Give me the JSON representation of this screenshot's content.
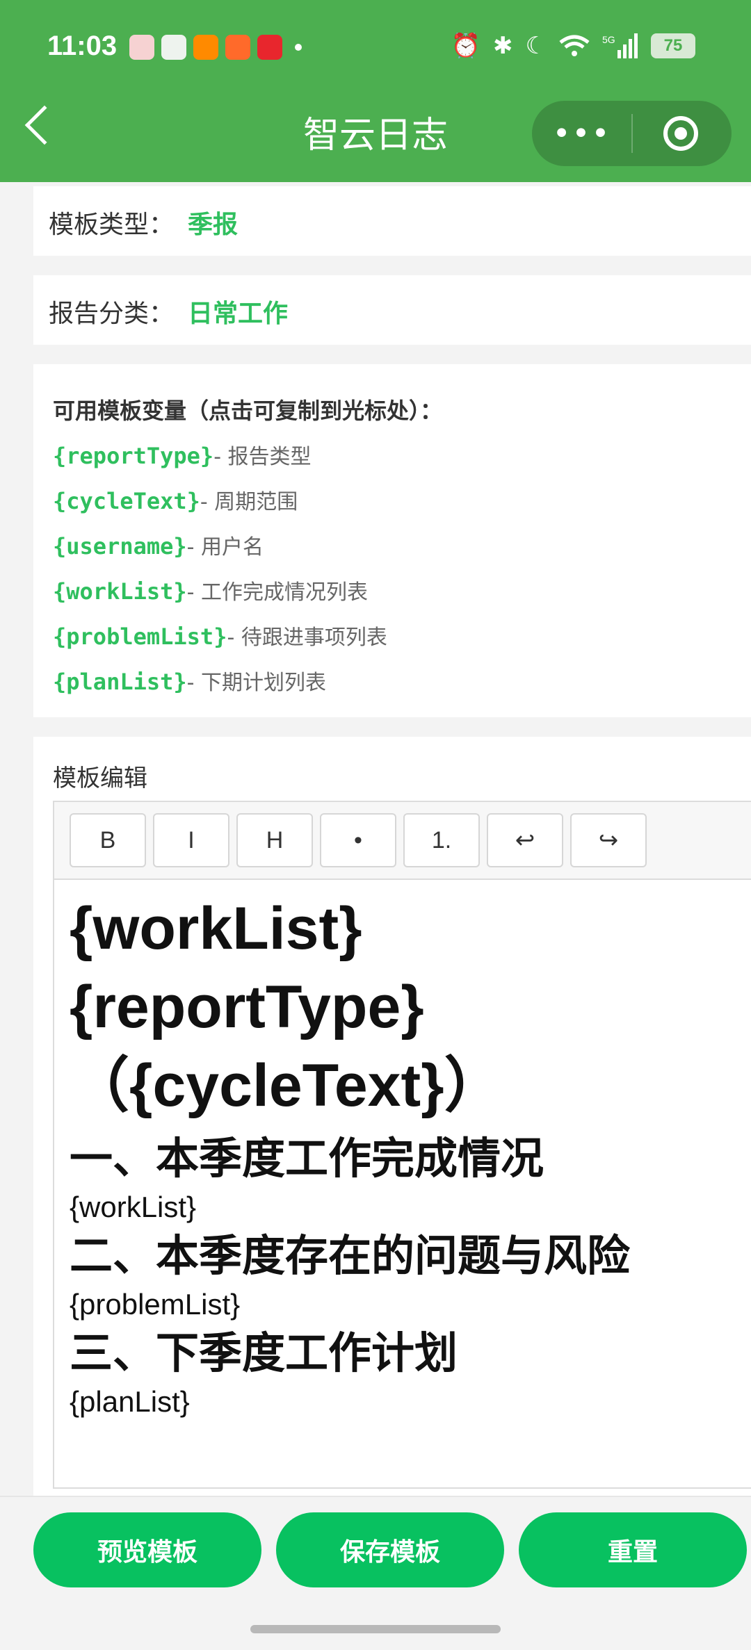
{
  "status_bar": {
    "time": "11:03",
    "battery": "75",
    "network": "5G"
  },
  "nav": {
    "title": "智云日志",
    "more": "•••"
  },
  "template_type": {
    "label": "模板类型：",
    "value": "季报"
  },
  "report_category": {
    "label": "报告分类：",
    "value": "日常工作"
  },
  "variables": {
    "title": "可用模板变量（点击可复制到光标处）：",
    "items": [
      {
        "code": "{reportType}",
        "desc": "- 报告类型"
      },
      {
        "code": "{cycleText}",
        "desc": "- 周期范围"
      },
      {
        "code": "{username}",
        "desc": "- 用户名"
      },
      {
        "code": "{workList}",
        "desc": "- 工作完成情况列表"
      },
      {
        "code": "{problemList}",
        "desc": "- 待跟进事项列表"
      },
      {
        "code": "{planList}",
        "desc": "- 下期计划列表"
      }
    ]
  },
  "editor": {
    "title": "模板编辑",
    "toolbar": [
      "B",
      "I",
      "H",
      "•",
      "1.",
      "↩",
      "↪"
    ],
    "content": {
      "heading1_line1": "{workList}",
      "heading1_line2": "{reportType}",
      "heading1_line3": "（{cycleText}）",
      "section1_title": "一、本季度工作完成情况",
      "section1_var": "{workList}",
      "section2_title": "二、本季度存在的问题与风险",
      "section2_var": "{problemList}",
      "section3_title": "三、下季度工作计划",
      "section3_var": "{planList}"
    }
  },
  "actions": {
    "preview": "预览模板",
    "save": "保存模板",
    "reset": "重置"
  },
  "colors": {
    "header": "#4caf50",
    "accent": "#2fbf5e",
    "button": "#08c160"
  }
}
